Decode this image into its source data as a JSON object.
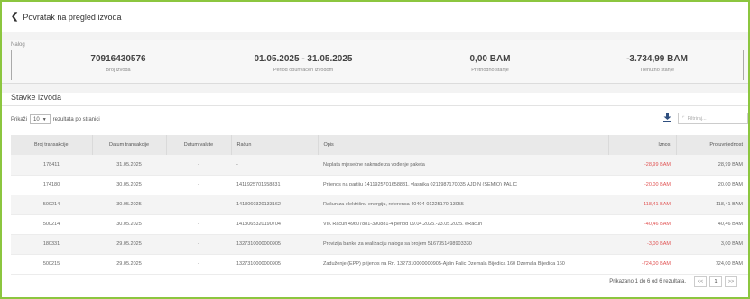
{
  "nav": {
    "back_label": "Povratak na pregled izvoda"
  },
  "summary": {
    "title": "Nalog",
    "statement_number": "70916430576",
    "statement_number_label": "Broj izvoda",
    "period": "01.05.2025 - 31.05.2025",
    "period_label": "Period obuhvaćen izvodom",
    "previous_balance": "0,00 BAM",
    "previous_balance_label": "Prethodno stanje",
    "current_balance": "-3.734,99 BAM",
    "current_balance_label": "Trenutno stanje"
  },
  "items": {
    "title": "Stavke izvoda",
    "show_prefix": "Prikaži",
    "page_size": "10",
    "show_suffix": "rezultata po stranici",
    "filter_placeholder": "Filtriraj...",
    "columns": [
      "Broj transakcije",
      "Datum transakcije",
      "Datum valute",
      "Račun",
      "Opis",
      "Iznos",
      "Protuvrijednost"
    ],
    "rows": [
      {
        "id": "178411",
        "date": "31.05.2025",
        "value_date": "-",
        "account": "-",
        "desc": "Naplata mjesečne naknade za vođenje paketa",
        "amount": "-28,99 BAM",
        "equiv": "28,99 BAM"
      },
      {
        "id": "174180",
        "date": "30.05.2025",
        "value_date": "-",
        "account": "1411925701658831",
        "desc": "Prijenos na partiju 1411925701658831, vlasnika 0211987170035 AJDIN (SEMIO) PALIC",
        "amount": "-20,00 BAM",
        "equiv": "20,00 BAM"
      },
      {
        "id": "500214",
        "date": "30.05.2025",
        "value_date": "-",
        "account": "1413060320133162",
        "desc": "Račun za električnu energiju, referenca 40404-01225170-13055",
        "amount": "-118,41 BAM",
        "equiv": "118,41 BAM"
      },
      {
        "id": "500214",
        "date": "30.05.2025",
        "value_date": "-",
        "account": "1413065320190704",
        "desc": "VIK Račun 49607881-390881-4 period 09.04.2025.-23.05.2025. eRačun",
        "amount": "-40,46 BAM",
        "equiv": "40,46 BAM"
      },
      {
        "id": "180331",
        "date": "29.05.2025",
        "value_date": "-",
        "account": "1327310000000905",
        "desc": "Provizija banke za realizaciju naloga sa brojem 5167351498903330",
        "amount": "-3,00 BAM",
        "equiv": "3,00 BAM"
      },
      {
        "id": "500215",
        "date": "29.05.2025",
        "value_date": "-",
        "account": "1327310000000905",
        "desc": "Zaduženje (EPP) prijenos na Rn. 1327310000000905-Ajdin Palic Dzemala Bijedica 160 Dzemala Bijedica 160",
        "amount": "-724,00 BAM",
        "equiv": "724,00 BAM"
      }
    ],
    "footer_text": "Prikazano 1 do 6 od 6 rezultata.",
    "pagination": {
      "prev": "<<",
      "current": "1",
      "next": ">>"
    }
  },
  "colors": {
    "negative": "#e15252",
    "frame": "#8cc63f"
  }
}
